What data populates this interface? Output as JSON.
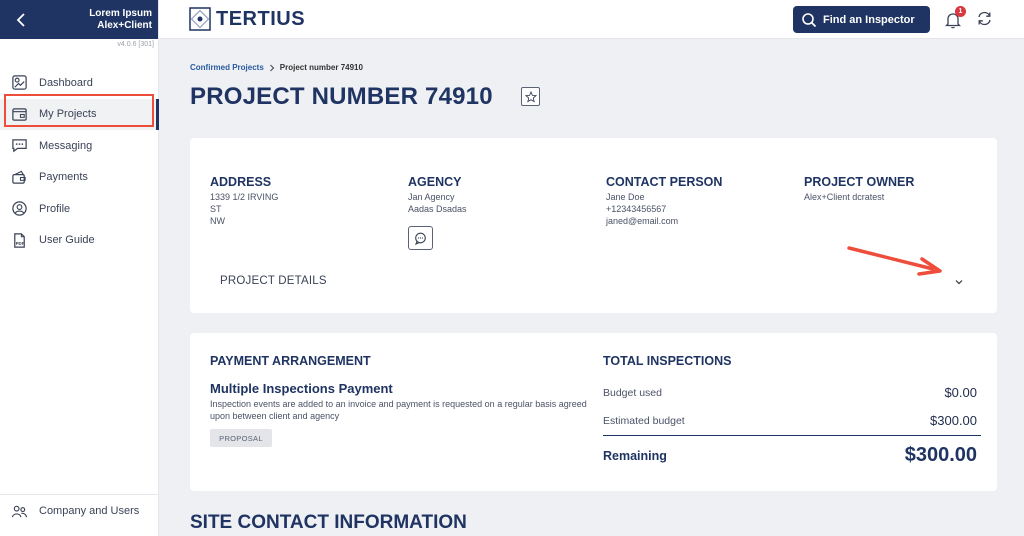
{
  "sidebar": {
    "user_name": "Lorem Ipsum",
    "user_role": "Alex+Client",
    "version": "v4.0.6 [301]",
    "items": [
      {
        "label": "Dashboard",
        "icon": "dashboard-icon"
      },
      {
        "label": "My Projects",
        "icon": "projects-icon"
      },
      {
        "label": "Messaging",
        "icon": "messaging-icon"
      },
      {
        "label": "Payments",
        "icon": "payments-icon"
      },
      {
        "label": "Profile",
        "icon": "profile-icon"
      },
      {
        "label": "User Guide",
        "icon": "pdf-icon"
      }
    ],
    "footer_item": {
      "label": "Company and Users",
      "icon": "users-icon"
    },
    "highlight_color": "#ef4d3c"
  },
  "header": {
    "logo_text": "TERTIUS",
    "find_inspector_label": "Find an Inspector",
    "notification_count": "1"
  },
  "breadcrumb": {
    "parent": "Confirmed Projects",
    "current": "Project number 74910"
  },
  "page_title": "PROJECT NUMBER 74910",
  "project_info": {
    "address": {
      "heading": "ADDRESS",
      "line1": "1339 1/2 IRVING",
      "line2": "ST",
      "line3": "NW"
    },
    "agency": {
      "heading": "AGENCY",
      "line1": "Jan Agency",
      "line2": "Aadas Dsadas"
    },
    "contact": {
      "heading": "CONTACT PERSON",
      "name": "Jane Doe",
      "phone": "+12343456567",
      "email": "janed@email.com"
    },
    "owner": {
      "heading": "PROJECT OWNER",
      "name": "Alex+Client dcratest"
    },
    "details_label": "PROJECT DETAILS"
  },
  "payment": {
    "heading": "PAYMENT ARRANGEMENT",
    "title": "Multiple Inspections Payment",
    "description": "Inspection events are added to an invoice and payment is requested on a regular basis agreed upon between client and agency",
    "status": "PROPOSAL"
  },
  "inspections": {
    "heading": "TOTAL INSPECTIONS",
    "budget_used_label": "Budget used",
    "budget_used_value": "$0.00",
    "estimated_label": "Estimated budget",
    "estimated_value": "$300.00",
    "remaining_label": "Remaining",
    "remaining_value": "$300.00"
  },
  "site_contact_heading": "SITE CONTACT INFORMATION",
  "colors": {
    "navy": "#1f3462",
    "accent_red": "#ef4d3c",
    "badge_red": "#d9363e",
    "background": "#eef0f3"
  }
}
